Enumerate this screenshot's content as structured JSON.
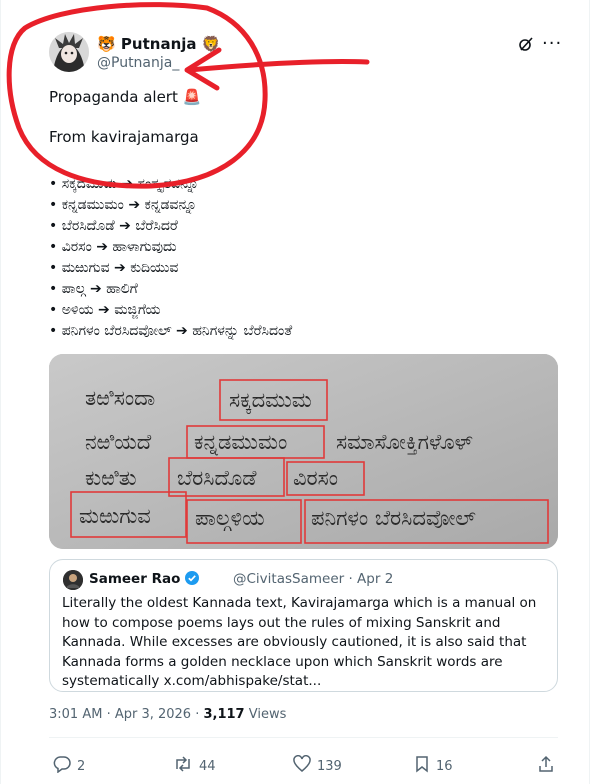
{
  "author": {
    "name": "Putnanja",
    "name_prefix_emoji": "🐯",
    "name_suffix_emoji": "🦁",
    "handle": "@Putnanja_"
  },
  "tweet": {
    "line1": "Propaganda alert 🚨",
    "line2": "From kavirajamarga",
    "bullets": [
      "• ಸಕ್ಕದಮುಮ ➔ ಸಂಸ್ಕೃತವನ್ನೂ",
      "• ಕನ್ನಡಮುಮಂ ➔ ಕನ್ನಡವನ್ನೂ",
      "• ಬೆರಸಿದೊಡೆ ➔ ಬೆರೆಸಿದರೆ",
      "• ವಿರಸಂ ➔ ಹಾಳಾಗುವುದು",
      "• ಮಱುಗುವ ➔ ಕುದಿಯುವ",
      "• ಪಾಲ್ಗ ➔ ಹಾಲಿಗೆ",
      "• ಅಳಿಯ ➔ ಮಜ್ಜಿಗೆಯ",
      "• ಪನಿಗಳಂ ಬೆರಸಿದವೋಲ್ ➔ ಹನಿಗಳನ್ನು ಬೆರೆಸಿದಂತೆ"
    ]
  },
  "photo": {
    "words": [
      "ತಱಿಸಂದಾ",
      "ಸಕ್ಕದಮುಮ",
      "ನಱಿಯದೆ",
      "ಕನ್ನಡಮುಮಂ",
      "ಸಮಾಸೋಕ್ತಿಗಳೊಳ್",
      "ಕುಱಿತು",
      "ಬೆರಸಿದೊಡೆ",
      "ವಿರಸಂ",
      "ಮಱುಗುವ",
      "ಪಾಲ್ಗಳಿಯ",
      "ಪನಿಗಳಂ ಬೆರಸಿದವೋಲ್"
    ]
  },
  "quote": {
    "name": "Sameer Rao",
    "handle_date": "@CivitasSameer · Apr 2",
    "body": "Literally the oldest Kannada text, Kavirajamarga which is a manual on how to compose poems lays out the rules of mixing Sanskrit and Kannada. While excesses are obviously cautioned, it is also said that Kannada forms a golden necklace upon which Sanskrit words are systematically x.com/abhispake/stat..."
  },
  "meta": {
    "time_date": "3:01 AM · Apr 3, 2026 · ",
    "views_count": "3,117",
    "views_label": " Views"
  },
  "actions": {
    "replies": "2",
    "reposts": "44",
    "likes": "139",
    "bookmarks": "16"
  },
  "colors": {
    "accent": "#1d9bf0",
    "annotation": "#e8202a",
    "muted": "#536471",
    "verified": "#1d9bf0"
  }
}
